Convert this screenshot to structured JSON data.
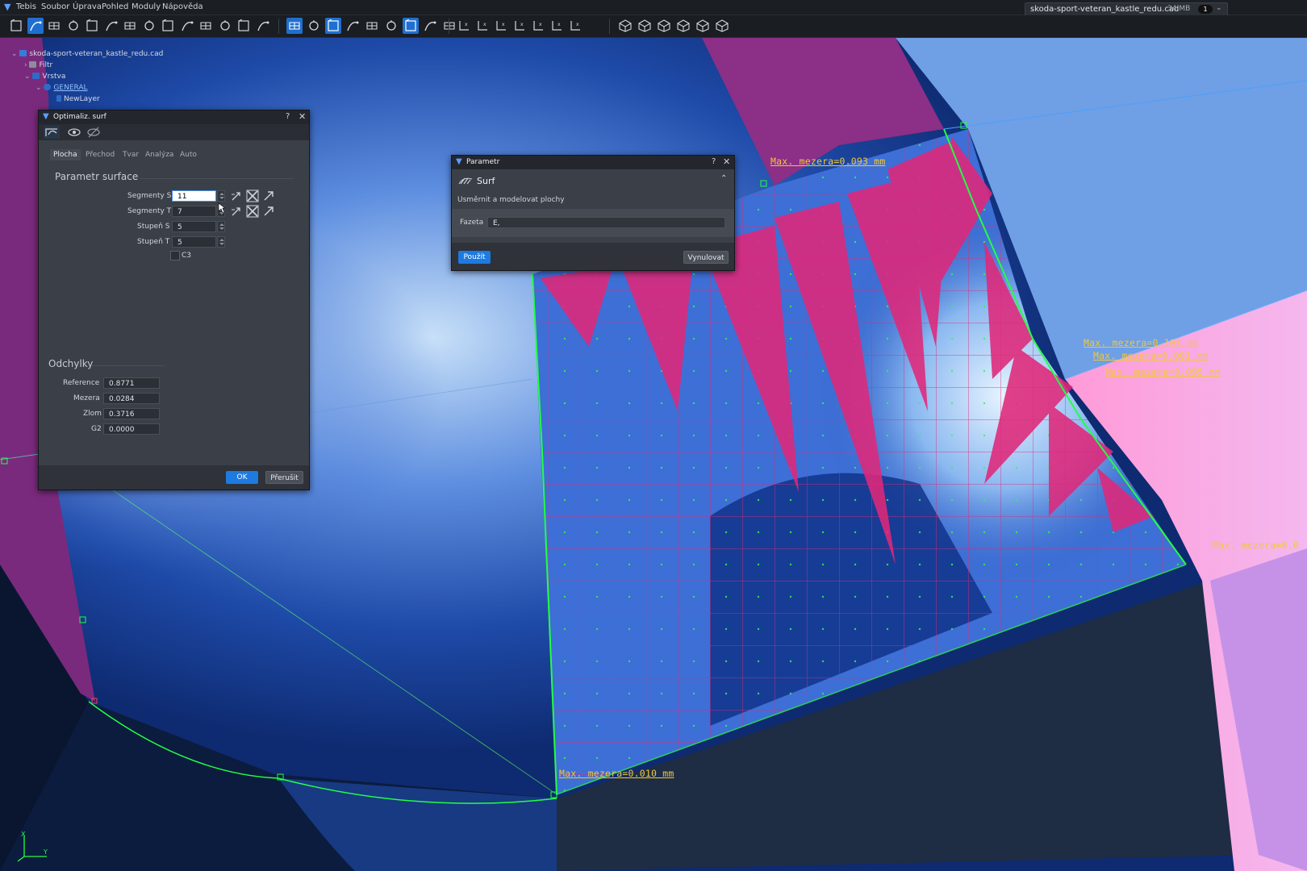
{
  "menu": {
    "app": "Tebis",
    "items": [
      "Soubor",
      "Úprava",
      "Pohled",
      "Moduly",
      "Nápověda"
    ]
  },
  "file": {
    "name": "skoda-sport-veteran_kastle_redu.cad",
    "memory": "34 MB",
    "count": "1"
  },
  "toolbar": {
    "icons": [
      "view-box-icon",
      "view-front-icon",
      "view-iso-icon",
      "refresh-icon",
      "zoom-icon",
      "pan-icon",
      "axis-icon",
      "rotate-icon",
      "grid-icon",
      "frame-icon",
      "curve-fan-icon",
      "arrow-down-icon",
      "arrow-curve-icon",
      "pointer-icon",
      "curve-fx-icon",
      "spline-icon",
      "surface-grid-icon",
      "surface-icon",
      "analysis-icon",
      "paint-icon",
      "optimize-surf-icon",
      "shaded-icon",
      "flat-icon",
      "axis-x-icon",
      "axis-xy-icon",
      "axis-xz-icon",
      "axis-yz-icon",
      "axis-z-icon",
      "axis-zx-icon",
      "axis-plain-icon",
      "cube-1-icon",
      "cube-2-icon",
      "cube-3-icon",
      "cube-4-icon",
      "cube-5-icon",
      "cube-6-icon"
    ]
  },
  "tree": {
    "root": "skoda-sport-veteran_kastle_redu.cad",
    "filtr": "Filtr",
    "vrstva": "Vrstva",
    "general": "GENERAL",
    "newlayer": "NewLayer"
  },
  "opt_dialog": {
    "title": "Optimaliz. surf",
    "help": "?",
    "tabs": [
      "Plocha",
      "Přechod",
      "Tvar",
      "Analýza",
      "Auto"
    ],
    "section1": "Parametr surface",
    "params": [
      {
        "label": "Segmenty S",
        "value": "11"
      },
      {
        "label": "Segmenty T",
        "value": "7"
      },
      {
        "label": "Stupeň S",
        "value": "5"
      },
      {
        "label": "Stupeň T",
        "value": "5"
      }
    ],
    "c3_label": "C3",
    "section2": "Odchylky",
    "deviations": [
      {
        "label": "Reference",
        "value": "0.8771"
      },
      {
        "label": "Mezera",
        "value": "0.0284"
      },
      {
        "label": "Zlom",
        "value": "0.3716"
      },
      {
        "label": "G2",
        "value": "0.0000"
      }
    ],
    "ok": "OK",
    "cancel": "Přerušit"
  },
  "param_dialog": {
    "title": "Parametr",
    "help": "?",
    "section": "Surf",
    "description": "Usměrnit a modelovat plochy",
    "fazeta_label": "Fazeta",
    "fazeta_value": "E,",
    "apply": "Použít",
    "reset": "Vynulovat"
  },
  "annotations": [
    "Max. mezera=0.093 mm",
    "Max. mezera=0.103 mm",
    "Max. mezera=0.001 mm",
    "Max. mezera=0.095 mm",
    "Max. mezera=0.0",
    "Max. mezera=0.010 mm"
  ],
  "axes": {
    "x": "X",
    "y": "Y"
  },
  "colors": {
    "accent": "#1f6fd1",
    "annotation": "#f0c83c",
    "surface_magenta": "#e0287a",
    "control_points": "#22ff44"
  }
}
